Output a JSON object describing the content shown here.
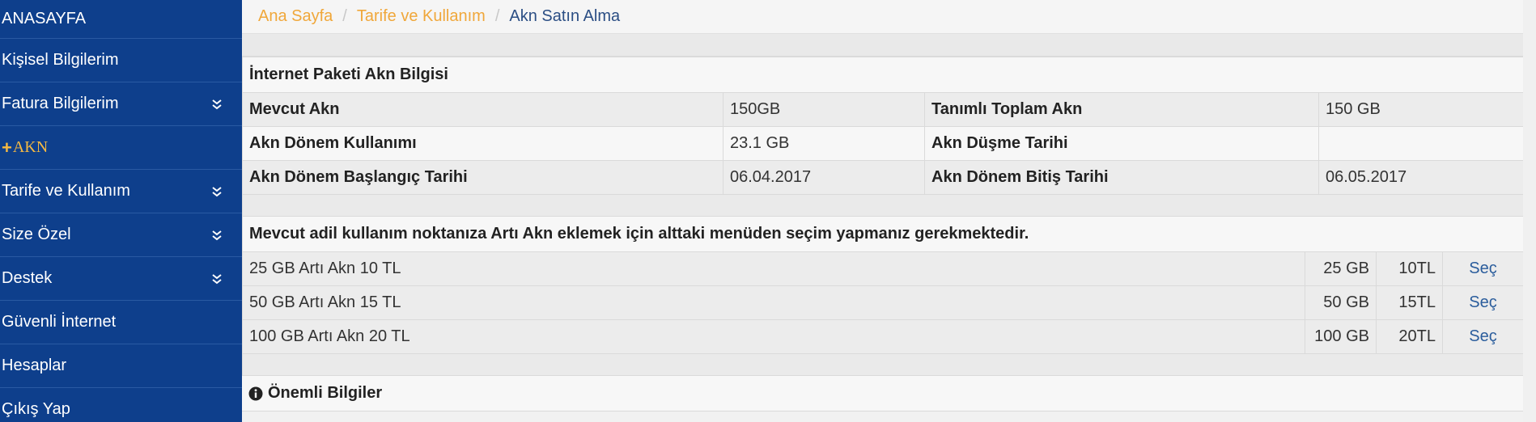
{
  "sidebar": {
    "items": [
      {
        "label": "ANASAYFA"
      },
      {
        "label": "Kişisel Bilgilerim"
      },
      {
        "label": "Fatura Bilgilerim"
      },
      {
        "label": "AKN"
      },
      {
        "label": "Tarife ve Kullanım"
      },
      {
        "label": "Size Özel"
      },
      {
        "label": "Destek"
      },
      {
        "label": "Güvenli İnternet"
      },
      {
        "label": "Hesaplar"
      },
      {
        "label": "Çıkış Yap"
      }
    ],
    "akn_plus": "+"
  },
  "breadcrumb": {
    "home": "Ana Sayfa",
    "tariff": "Tarife ve Kullanım",
    "current": "Akn Satın Alma",
    "sep": "/"
  },
  "akn_info": {
    "title": "İnternet Paketi Akn Bilgisi",
    "rows": [
      {
        "l1": "Mevcut Akn",
        "v1": "150GB",
        "l2": "Tanımlı Toplam Akn",
        "v2": "150 GB"
      },
      {
        "l1": "Akn Dönem Kullanımı",
        "v1": "23.1 GB",
        "l2": "Akn Düşme Tarihi",
        "v2": ""
      },
      {
        "l1": "Akn Dönem Başlangıç Tarihi",
        "v1": "06.04.2017",
        "l2": "Akn Dönem Bitiş Tarihi",
        "v2": "06.05.2017"
      }
    ]
  },
  "packages": {
    "title": "Mevcut adil kullanım noktanıza Artı Akn eklemek için alttaki menüden seçim yapmanız gerekmektedir.",
    "items": [
      {
        "name": "25 GB Artı Akn 10 TL",
        "size": "25 GB",
        "price": "10TL",
        "action": "Seç"
      },
      {
        "name": "50 GB Artı Akn 15 TL",
        "size": "50 GB",
        "price": "15TL",
        "action": "Seç"
      },
      {
        "name": "100 GB Artı Akn 20 TL",
        "size": "100 GB",
        "price": "20TL",
        "action": "Seç"
      }
    ]
  },
  "important": {
    "title": "Önemli Bilgiler",
    "icon": "info-circle-icon"
  },
  "colors": {
    "sidebar_bg": "#0e3f8c",
    "accent_orange": "#f0a73a",
    "link_blue": "#2b5d9c"
  }
}
